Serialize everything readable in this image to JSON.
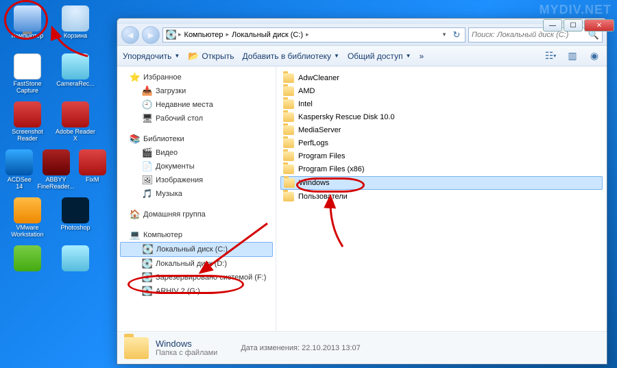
{
  "watermark": "MYDIV.NET",
  "desktop": {
    "rows": [
      [
        {
          "label": "Компьютер",
          "icon": "monitor"
        },
        {
          "label": "Корзина",
          "icon": "bin"
        }
      ],
      [
        {
          "label": "FastStone Capture",
          "icon": "white"
        },
        {
          "label": "CameraRec...",
          "icon": "cyan"
        }
      ],
      [
        {
          "label": "Screenshot Reader",
          "icon": "red"
        },
        {
          "label": "Adobe Reader X",
          "icon": "red"
        }
      ],
      [
        {
          "label": "ACDSee 14",
          "icon": "blue"
        },
        {
          "label": "ABBYY FineReader...",
          "icon": "darkred"
        },
        {
          "label": "FixM",
          "icon": "red"
        }
      ],
      [
        {
          "label": "VMware Workstation",
          "icon": "orange"
        },
        {
          "label": "Photoshop",
          "icon": "dkblue"
        }
      ],
      [
        {
          "label": "",
          "icon": "green"
        },
        {
          "label": "",
          "icon": "cyan"
        }
      ]
    ]
  },
  "explorer": {
    "breadcrumb": [
      "Компьютер",
      "Локальный диск (C:)"
    ],
    "search_placeholder": "Поиск: Локальный диск (C:)",
    "toolbar": {
      "organize": "Упорядочить",
      "open": "Открыть",
      "add_to_library": "Добавить в библиотеку",
      "share": "Общий доступ"
    },
    "nav": {
      "favorites": {
        "label": "Избранное",
        "items": [
          "Загрузки",
          "Недавние места",
          "Рабочий стол"
        ]
      },
      "libraries": {
        "label": "Библиотеки",
        "items": [
          "Видео",
          "Документы",
          "Изображения",
          "Музыка"
        ]
      },
      "homegroup": {
        "label": "Домашняя группа"
      },
      "computer": {
        "label": "Компьютер",
        "items": [
          {
            "label": "Локальный диск (C:)",
            "selected": true
          },
          {
            "label": "Локальный диск (D:)"
          },
          {
            "label": "Зарезервировано системой (F:)"
          },
          {
            "label": "ARHIV 2 (G:)"
          }
        ]
      }
    },
    "content": [
      {
        "label": "AdwCleaner"
      },
      {
        "label": "AMD"
      },
      {
        "label": "Intel"
      },
      {
        "label": "Kaspersky Rescue Disk 10.0"
      },
      {
        "label": "MediaServer"
      },
      {
        "label": "PerfLogs"
      },
      {
        "label": "Program Files"
      },
      {
        "label": "Program Files (x86)"
      },
      {
        "label": "Windows",
        "selected": true
      },
      {
        "label": "Пользователи"
      }
    ],
    "details": {
      "name": "Windows",
      "type": "Папка с файлами",
      "modified_label": "Дата изменения:",
      "modified_value": "22.10.2013 13:07"
    }
  }
}
